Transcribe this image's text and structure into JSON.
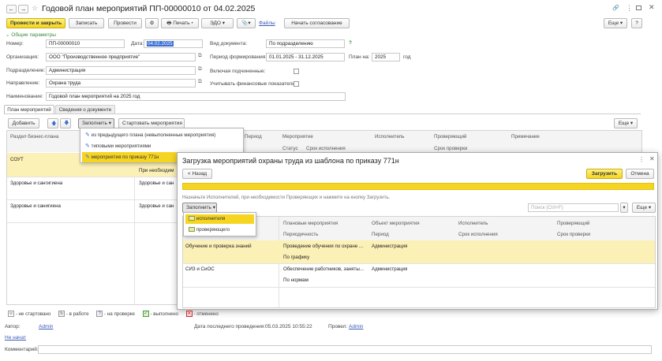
{
  "window": {
    "title": "Годовой план мероприятий ПП-00000010 от 04.02.2025",
    "back": "←",
    "forward": "→",
    "star": "☆",
    "link_icon": "🔗",
    "more": "⋮",
    "close": "✕"
  },
  "toolbar": {
    "post_close": "Провести и закрыть",
    "save": "Записать",
    "post": "Провести",
    "print": "Печать",
    "edo": "ЭДО",
    "files": "Файлы",
    "start_approval": "Начать согласование",
    "more": "Еще"
  },
  "general": {
    "section": "Общие параметры",
    "number_label": "Номер:",
    "number": "ПП-00000010",
    "date_label": "Дата:",
    "date": "04.02.2025",
    "doctype_label": "Вид документа:",
    "doctype": "По подразделению",
    "org_label": "Организация:",
    "org": "ООО \"Производственное предприятие\"",
    "period_label": "Период формирования:",
    "period": "01.01.2025 - 31.12.2025",
    "plan_label": "План на:",
    "plan_year": "2025",
    "year_suffix": "год",
    "dept_label": "Подразделение:",
    "dept": "Администрация",
    "incl_sub_label": "Включая подчиненные:",
    "dir_label": "Направление:",
    "dir": "Охрана труда",
    "fin_label": "Учитывать финансовые показатели:",
    "name_label": "Наименование:",
    "name": "Годовой план мероприятий на 2025 год",
    "help": "?"
  },
  "tabs": {
    "plan": "План мероприятий",
    "info": "Сведения о документе"
  },
  "plan_toolbar": {
    "add": "Добавить",
    "fill": "Заполнить",
    "start": "Стартовать мероприятия",
    "more": "Еще"
  },
  "fill_menu": {
    "items": [
      "из предыдущего плана (невыполненные мероприятия)",
      "типовыми мероприятиями",
      "мероприятия по приказу 771н"
    ]
  },
  "main_grid": {
    "headers": [
      "Раздел бизнес-плана",
      "Период",
      "Мероприятие",
      "Исполнитель",
      "Проверяющий",
      "Примечание"
    ],
    "subheaders": [
      "Статус",
      "Срок исполнения",
      "Срок проверки"
    ],
    "rows": [
      {
        "section": "СОУТ",
        "event": "При необходим"
      },
      {
        "section": "Здоровье и сангигиена",
        "event": "Здоровье и сан"
      },
      {
        "section": "Здоровье и санигиена",
        "event": "Здоровье и сан"
      }
    ]
  },
  "dialog": {
    "title": "Загрузка мероприятий охраны труда из шаблона по приказу 771н",
    "back": "< Назад",
    "load": "Загрузить",
    "cancel": "Отмена",
    "hint": "Назначьте Исполнителей, при необходимости Проверяющих и нажмите на кнопку Загрузить.",
    "fill": "Заполнить",
    "search_placeholder": "Поиск (Ctrl+F)",
    "more": "Еще",
    "fill_menu": [
      "исполнителя",
      "проверяющего"
    ],
    "headers": [
      "Плановые мероприятия",
      "Объект мероприятия",
      "Исполнитель",
      "Проверяющий"
    ],
    "subheaders": [
      "Периодичность",
      "Период",
      "Срок исполнения",
      "Срок проверки"
    ],
    "rows": [
      {
        "group": "Обучение и проверка знаний",
        "event": "Проведение обучения по охране ...",
        "object": "Администрация",
        "period": "По графику"
      },
      {
        "group": "СИЗ и СиОС",
        "event": "Обеспечение работников, заняты...",
        "object": "Администрация",
        "period": "По нормам"
      }
    ]
  },
  "legend": {
    "not_started": "- не стартовано",
    "in_work": "- в работе",
    "on_check": "- на проверке",
    "done": "- выполнено",
    "cancelled": "- отменено"
  },
  "footer": {
    "author_label": "Автор:",
    "author": "Admin",
    "last_post_label": "Дата последнего проведения:",
    "last_post": "05.03.2025 10:55:22",
    "posted_label": "Провел:",
    "posted": "Admin",
    "not_started": "Не начат",
    "comment_label": "Комментарий:"
  },
  "colors": {
    "accent_yellow": "#f5d422",
    "row_highlight": "#fbf0b6",
    "link": "#3b5bb5"
  }
}
